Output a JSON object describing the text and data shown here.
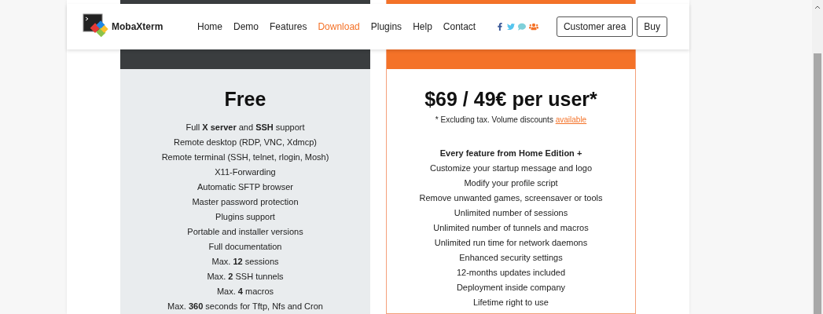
{
  "brand": {
    "name": "MobaXterm"
  },
  "nav": [
    {
      "label": "Home",
      "selected": false
    },
    {
      "label": "Demo",
      "selected": false
    },
    {
      "label": "Features",
      "selected": false
    },
    {
      "label": "Download",
      "selected": true
    },
    {
      "label": "Plugins",
      "selected": false
    },
    {
      "label": "Help",
      "selected": false
    },
    {
      "label": "Contact",
      "selected": false
    }
  ],
  "social": [
    {
      "kind": "facebook",
      "color": "#3b5998"
    },
    {
      "kind": "twitter",
      "color": "#55c5ef"
    },
    {
      "kind": "chat",
      "color": "#7fd0da"
    },
    {
      "kind": "group",
      "color": "#f47228"
    }
  ],
  "actions": [
    "Customer area",
    "Buy"
  ],
  "plans": [
    {
      "kind": "home",
      "price": "Free",
      "features": [
        "Full **X server** and **SSH** support",
        "Remote desktop (RDP, VNC, Xdmcp)",
        "Remote terminal (SSH, telnet, rlogin, Mosh)",
        "X11-Forwarding",
        "Automatic SFTP browser",
        "Master password protection",
        "Plugins support",
        "Portable and installer versions",
        "Full documentation",
        "Max. **12** sessions",
        "Max. **2** SSH tunnels",
        "Max. **4** macros",
        "Max. **360** seconds for Tftp, Nfs and Cron"
      ]
    },
    {
      "kind": "professional",
      "price": "$69 / 49€ per user*",
      "note": "* Excluding tax. Volume discounts",
      "note_link": "available",
      "intro": "Every feature from Home Edition +",
      "features": [
        "Customize your startup message and logo",
        "Modify your profile script",
        "Remove unwanted games, screensaver or tools",
        "Unlimited number of sessions",
        "Unlimited number of tunnels and macros",
        "Unlimited run time for network daemons",
        "Enhanced security settings",
        "12-months updates included",
        "Deployment inside company",
        "Lifetime right to use"
      ]
    }
  ]
}
